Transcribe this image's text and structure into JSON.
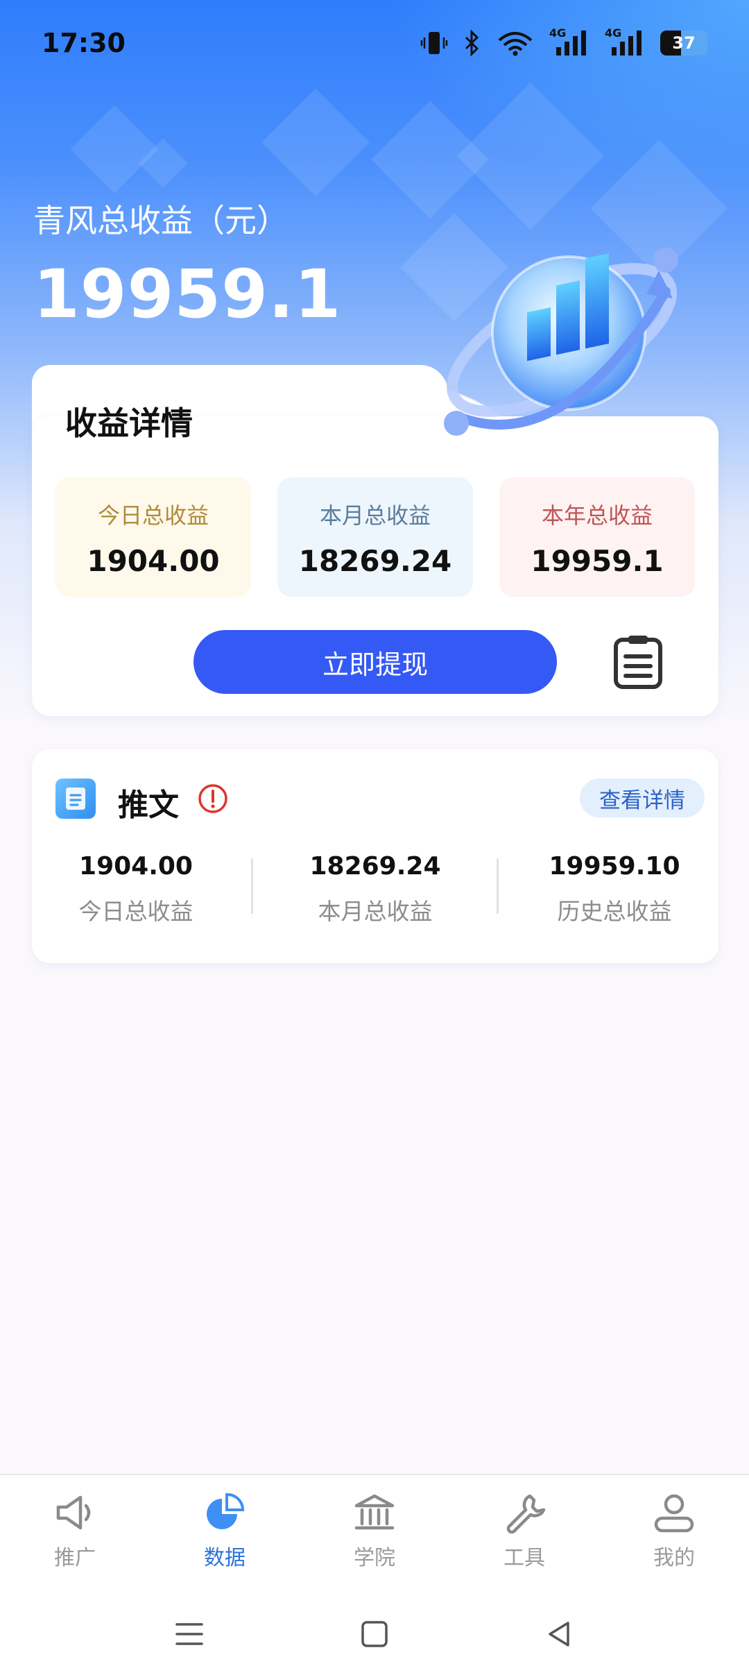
{
  "status_bar": {
    "time": "17:30",
    "battery": "37",
    "network_1": "4G",
    "network_2": "4G"
  },
  "hero": {
    "title": "青风总收益（元）",
    "amount": "19959.1"
  },
  "detail_card": {
    "heading": "收益详情",
    "today": {
      "label": "今日总收益",
      "value": "1904.00"
    },
    "month": {
      "label": "本月总收益",
      "value": "18269.24"
    },
    "year": {
      "label": "本年总收益",
      "value": "19959.1"
    },
    "withdraw_label": "立即提现",
    "records_icon": "clipboard-list-icon"
  },
  "tweet_card": {
    "title": "推文",
    "detail_link": "查看详情",
    "stats": [
      {
        "value": "1904.00",
        "label": "今日总收益"
      },
      {
        "value": "18269.24",
        "label": "本月总收益"
      },
      {
        "value": "19959.10",
        "label": "历史总收益"
      }
    ]
  },
  "bottom_nav": {
    "items": [
      {
        "label": "推广",
        "icon": "megaphone-icon",
        "active": false
      },
      {
        "label": "数据",
        "icon": "pie-chart-icon",
        "active": true
      },
      {
        "label": "学院",
        "icon": "bank-icon",
        "active": false
      },
      {
        "label": "工具",
        "icon": "wrench-icon",
        "active": false
      },
      {
        "label": "我的",
        "icon": "user-icon",
        "active": false
      }
    ]
  },
  "colors": {
    "accent": "#3559f5",
    "nav_active": "#2e73d9",
    "nav_inactive": "#9a9a9a",
    "alert": "#d9362b"
  }
}
